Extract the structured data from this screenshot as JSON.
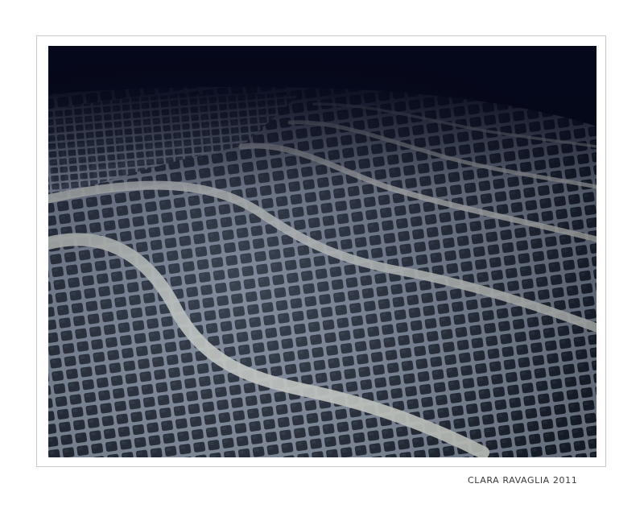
{
  "photo": {
    "subject": "cobblestone-pavement",
    "palette": {
      "night_sky": "#05081a",
      "stone_dark": "#1c2430",
      "stone_light": "#9aa6b8",
      "band_white": "#e8ece4",
      "mat_border": "#c9c9c9"
    }
  },
  "credit": {
    "text": "CLARA RAVAGLIA 2011"
  }
}
